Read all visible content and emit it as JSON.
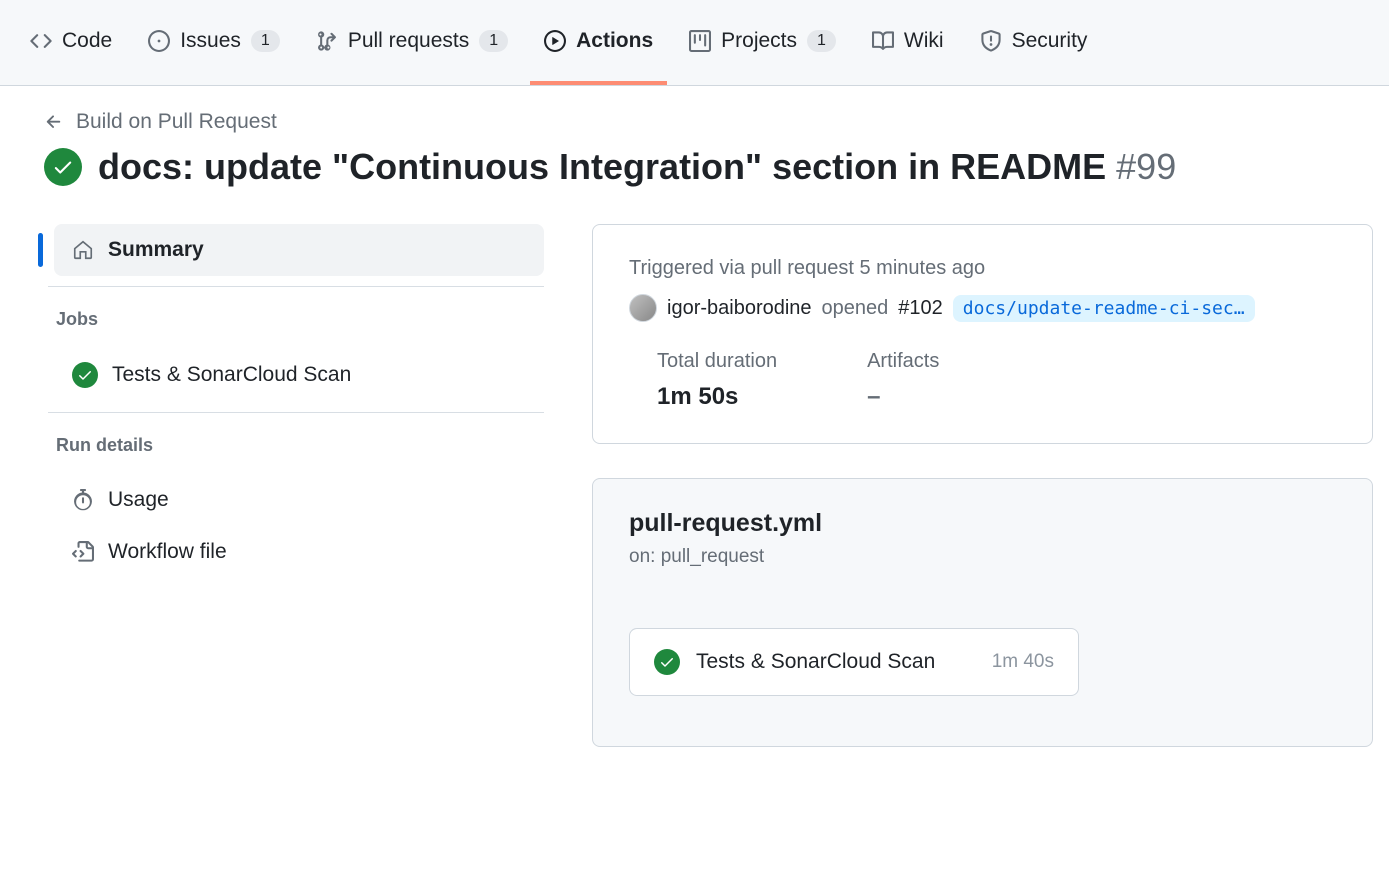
{
  "nav": {
    "code": "Code",
    "issues": "Issues",
    "issues_count": "1",
    "pulls": "Pull requests",
    "pulls_count": "1",
    "actions": "Actions",
    "projects": "Projects",
    "projects_count": "1",
    "wiki": "Wiki",
    "security": "Security"
  },
  "header": {
    "breadcrumb": "Build on Pull Request",
    "title": "docs: update \"Continuous Integration\" section in README",
    "run_number": "#99"
  },
  "sidebar": {
    "summary": "Summary",
    "jobs_heading": "Jobs",
    "job1": "Tests & SonarCloud Scan",
    "run_details_heading": "Run details",
    "usage": "Usage",
    "workflow_file": "Workflow file"
  },
  "summary": {
    "triggered_prefix": "Triggered via pull request",
    "triggered_time": "5 minutes ago",
    "user": "igor-baiborodine",
    "action": "opened",
    "pr_number": "#102",
    "branch": "docs/update-readme-ci-sec…",
    "duration_label": "Total duration",
    "duration_value": "1m 50s",
    "artifacts_label": "Artifacts",
    "artifacts_value": "–"
  },
  "workflow": {
    "file": "pull-request.yml",
    "on": "on: pull_request",
    "job_name": "Tests & SonarCloud Scan",
    "job_time": "1m 40s"
  }
}
